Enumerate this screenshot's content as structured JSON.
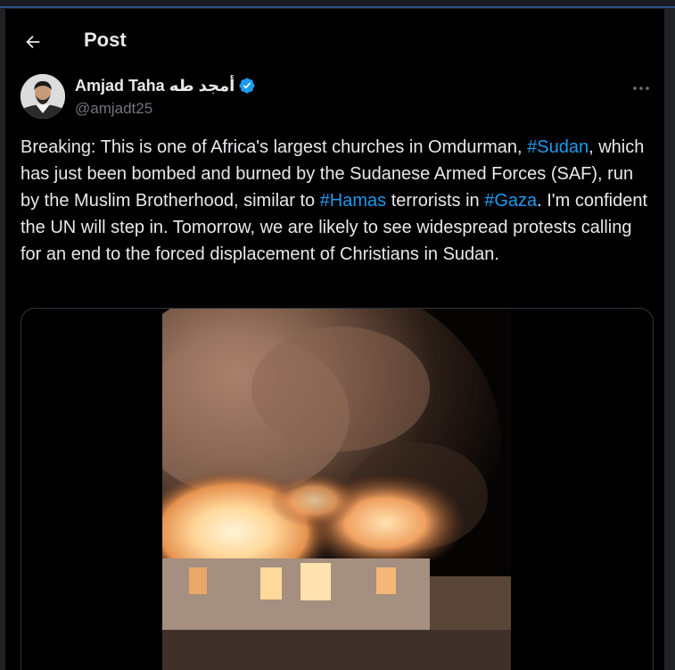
{
  "header": {
    "title": "Post"
  },
  "author": {
    "display_name": "Amjad Taha أمجد طه",
    "handle": "@amjadt25"
  },
  "tweet": {
    "text_parts": [
      "Breaking: This is one of Africa's largest churches in Omdurman, ",
      "#Sudan",
      ", which has just been bombed and burned by the Sudanese Armed Forces (SAF), run by the Muslim Brotherhood, similar to ",
      "#Hamas",
      " terrorists in ",
      "#Gaza",
      ". I'm confident the UN will step in. Tomorrow, we are likely to see widespread protests calling for an end to the forced displacement of Christians in Sudan."
    ]
  },
  "colors": {
    "background": "#000000",
    "text": "#e7e9ea",
    "secondary": "#71767b",
    "link": "#1d9bf0",
    "border": "#2f3336"
  },
  "icons": {
    "back": "arrow-left-icon",
    "verified": "verified-badge-icon",
    "more": "more-horizontal-icon"
  }
}
